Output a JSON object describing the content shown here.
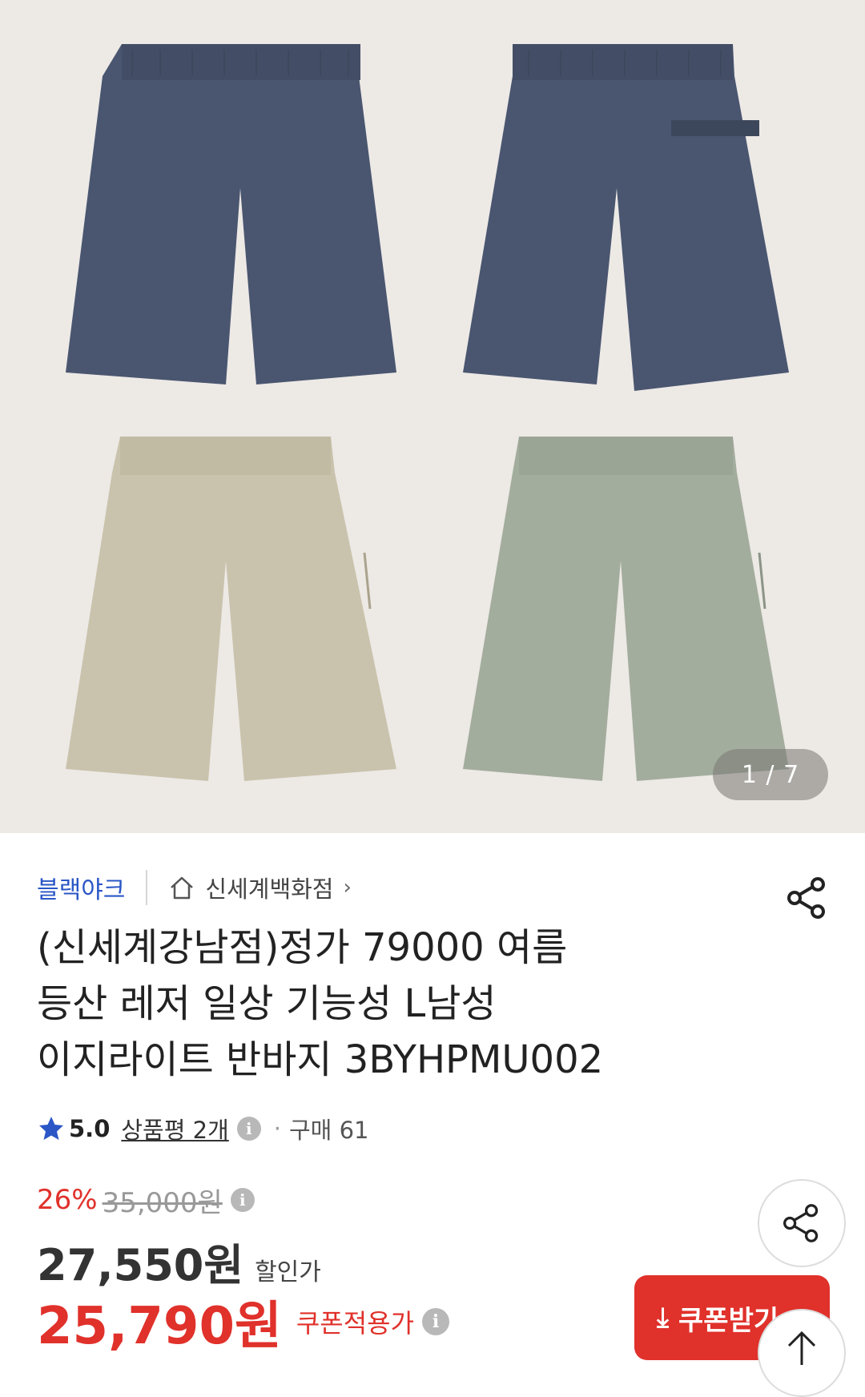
{
  "gallery": {
    "counter": "1 / 7",
    "colors": {
      "background": "#ede9e5",
      "navy": "#4a5670",
      "beige": "#c9c3ad",
      "sage": "#a3ad9e"
    }
  },
  "product": {
    "brand": "블랙야크",
    "store": "신세계백화점",
    "title_lines": [
      "(신세계강남점)정가 79000 여름",
      "등산 레저 일상 기능성  L남성",
      "이지라이트 반바지 3BYHPMU002"
    ],
    "rating_score": "5.0",
    "review_text": "상품평 2개",
    "purchase_text": "구매 61"
  },
  "pricing": {
    "discount_pct": "26%",
    "original_price": "35,000원",
    "sale_price": "27,550원",
    "sale_label": "할인가",
    "coupon_price": "25,790원",
    "coupon_label": "쿠폰적용가",
    "coupon_button": "쿠폰받기"
  },
  "icons": {
    "share": "share-icon",
    "home": "home-icon",
    "star": "star-icon",
    "info": "info-icon",
    "download": "download-icon",
    "arrow_up": "arrow-up-icon"
  },
  "accent_colors": {
    "brand_blue": "#2a56c6",
    "red": "#e0312b"
  }
}
